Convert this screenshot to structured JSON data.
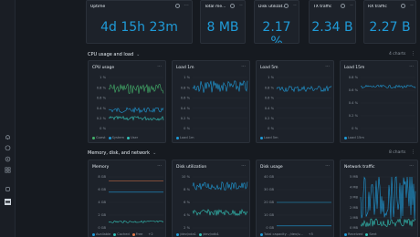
{
  "sidebar": {
    "icons": [
      "bell-icon",
      "chat-icon",
      "gear-icon",
      "grid-icon",
      "bug-icon",
      "profile-icon"
    ]
  },
  "stats": [
    {
      "title": "Uptime",
      "value": "4d 15h 23m"
    },
    {
      "title": "Total me...",
      "value": "8 MB"
    },
    {
      "title": "Disk utilizat...",
      "value": "2.17 %"
    },
    {
      "title": "TX traffic",
      "value": "2.34 B"
    },
    {
      "title": "RX traffic",
      "value": "2.27 B"
    }
  ],
  "sections": [
    {
      "title": "CPU usage and load",
      "count": "4 charts"
    },
    {
      "title": "Memory, disk, and network",
      "count": "8 charts"
    }
  ],
  "cpu_charts": [
    {
      "title": "CPU usage",
      "ticks": [
        "1 %",
        "0.8 %",
        "0.6 %",
        "0.4 %",
        "0.2 %",
        "0 %"
      ],
      "legend": [
        "Guest",
        "System",
        "User"
      ],
      "colors": [
        "#44b36b",
        "#1f9bd8",
        "#33c2b7"
      ]
    },
    {
      "title": "Load 1m",
      "ticks": [
        "1 %",
        "0.8 %",
        "0.6 %",
        "0.4 %",
        "0.2 %",
        "0 %"
      ],
      "legend": [
        "Load 1m"
      ],
      "colors": [
        "#1f9bd8"
      ]
    },
    {
      "title": "Load 5m",
      "ticks": [
        "1 %",
        "0.8 %",
        "0.6 %",
        "0.4 %",
        "0.2 %",
        "0 %"
      ],
      "legend": [
        "Load 5m"
      ],
      "colors": [
        "#1f9bd8"
      ]
    },
    {
      "title": "Load 15m",
      "ticks": [
        "0.8 %",
        "0.6 %",
        "0.4 %",
        "0.2 %",
        "0 %"
      ],
      "legend": [
        "Load 15m"
      ],
      "colors": [
        "#1f9bd8"
      ]
    }
  ],
  "mem_charts": [
    {
      "title": "Memory",
      "ticks": [
        "8 GB",
        "6 GB",
        "4 GB",
        "2 GB",
        "0 GB"
      ],
      "legend": [
        "Available",
        "Cached",
        "Free"
      ],
      "colors": [
        "#1f9bd8",
        "#33c2b7",
        "#e3784a"
      ],
      "more": "+2"
    },
    {
      "title": "Disk utilization",
      "ticks": [
        "10 %",
        "8 %",
        "6 %",
        "4 %",
        "2 %"
      ],
      "legend": [
        "/dev/vda1",
        "/dev/vdb1"
      ],
      "colors": [
        "#1f9bd8",
        "#33c2b7"
      ]
    },
    {
      "title": "Disk usage",
      "ticks": [
        "40 GB",
        "30 GB",
        "20 GB",
        "10 GB",
        "0 GB"
      ],
      "legend": [
        "Total capacity - /dev/v..."
      ],
      "colors": [
        "#1f9bd8"
      ],
      "more": "+5"
    },
    {
      "title": "Network traffic",
      "ticks": [
        "5 MB",
        "4 MB",
        "3 MB",
        "2 MB",
        "1 MB",
        "0 MB"
      ],
      "legend": [
        "Received",
        "Sent"
      ],
      "colors": [
        "#1f9bd8",
        "#33c2b7"
      ]
    }
  ]
}
